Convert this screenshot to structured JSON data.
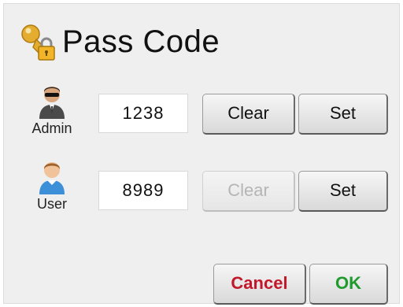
{
  "dialog": {
    "title": "Pass Code",
    "title_icon": "key-lock-icon"
  },
  "users": [
    {
      "label": "Admin",
      "icon": "admin-avatar-icon",
      "code": "1238",
      "clear_label": "Clear",
      "clear_enabled": true,
      "set_label": "Set"
    },
    {
      "label": "User",
      "icon": "user-avatar-icon",
      "code": "8989",
      "clear_label": "Clear",
      "clear_enabled": false,
      "set_label": "Set"
    }
  ],
  "actions": {
    "cancel_label": "Cancel",
    "ok_label": "OK"
  },
  "colors": {
    "cancel_text": "#c2182b",
    "ok_text": "#1f9a2c",
    "disabled_text": "#b5b5b5",
    "key_gold": "#e0a526"
  }
}
